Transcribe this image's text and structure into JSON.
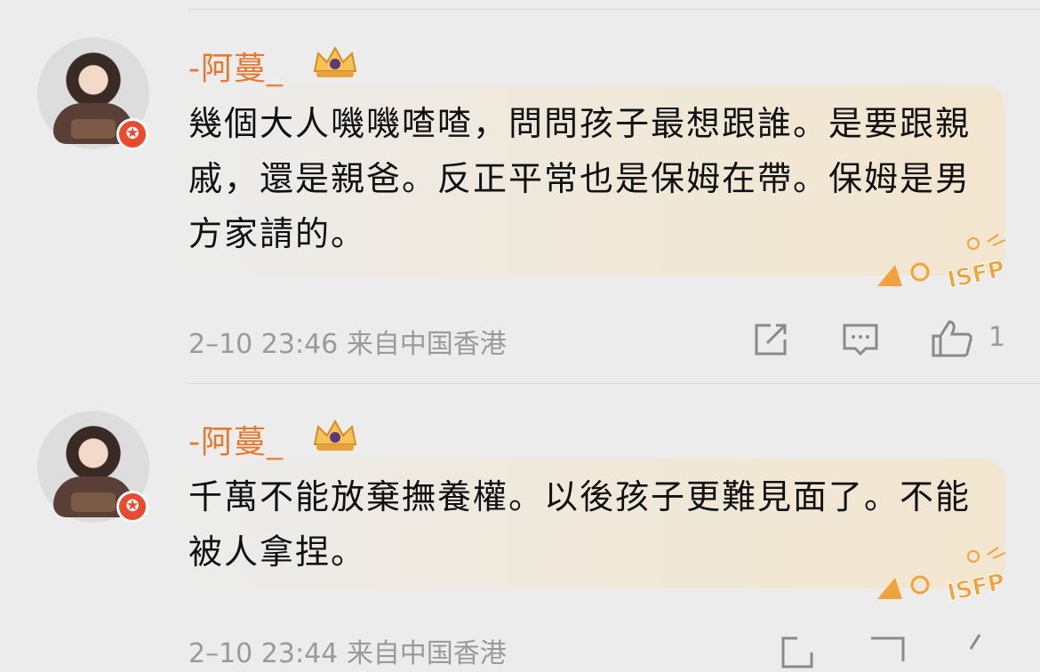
{
  "comments": [
    {
      "username": "-阿蔓_",
      "text": "幾個大人嘰嘰喳喳，問問孩子最想跟誰。是要跟親戚，還是親爸。反正平常也是保姆在帶。保姆是男方家請的。",
      "date": "2–10 23:46",
      "location": "来自中国香港",
      "like_count": "1",
      "sticker_text": "ISFP",
      "badge_icon": "crown-badge-icon"
    },
    {
      "username": "-阿蔓_",
      "text": "千萬不能放棄撫養權。以後孩子更難見面了。不能被人拿捏。",
      "date": "2–10 23:44",
      "location": "来自中国香港",
      "like_count": "",
      "sticker_text": "ISFP",
      "badge_icon": "crown-badge-icon"
    }
  ],
  "colors": {
    "username": "#e8772e",
    "vip_badge": "#e84b2f",
    "sticker": "#f2a23a",
    "meta": "#9a9a9a"
  }
}
